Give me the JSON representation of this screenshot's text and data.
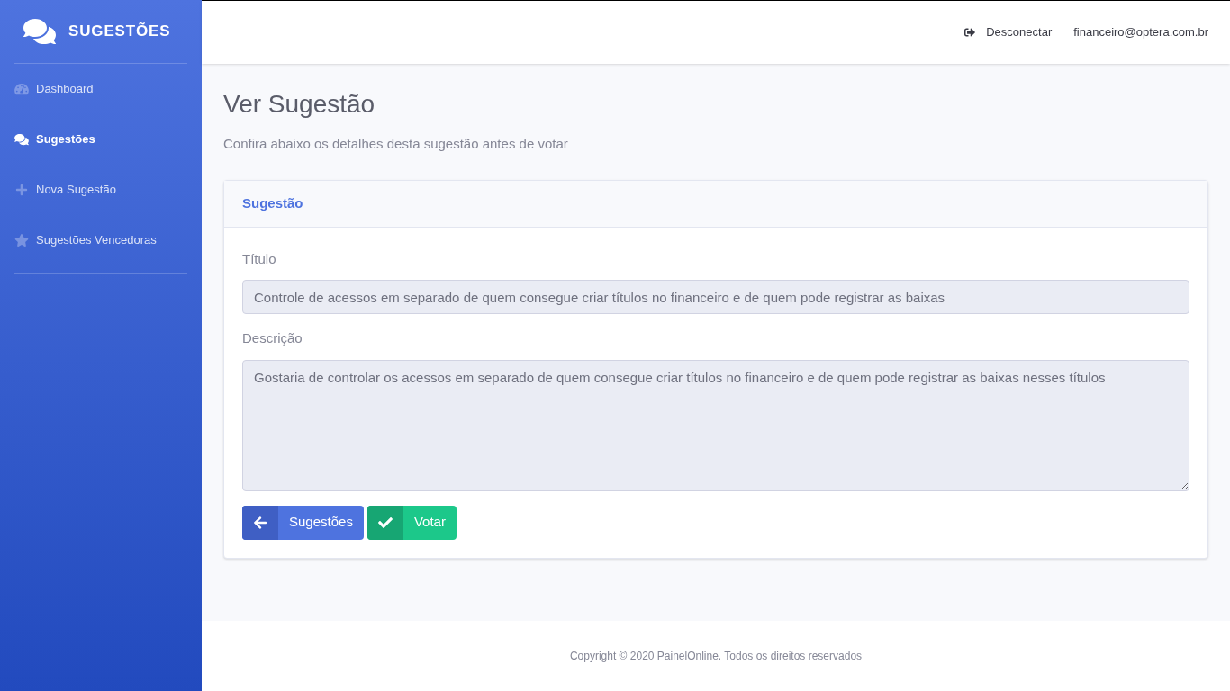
{
  "sidebar": {
    "brand": "SUGESTÕES",
    "items": [
      {
        "label": "Dashboard",
        "kind": "dashboard",
        "selected": false
      },
      {
        "label": "Sugestões",
        "kind": "list",
        "selected": true
      },
      {
        "label": "Nova Sugestão",
        "kind": "new",
        "selected": false
      },
      {
        "label": "Sugestões Vencedoras",
        "kind": "winners",
        "selected": false
      }
    ]
  },
  "topbar": {
    "logout": "Desconectar",
    "user": "financeiro@optera.com.br"
  },
  "page": {
    "title": "Ver Sugestão",
    "subtitle": "Confira abaixo os detalhes desta sugestão antes de votar"
  },
  "card": {
    "header": "Sugestão",
    "fields": [
      {
        "label": "Título",
        "kind": "input",
        "value": "Controle de acessos em separado de quem consegue criar títulos no financeiro e de quem pode registrar as baixas"
      },
      {
        "label": "Descrição",
        "kind": "textarea",
        "value": "Gostaria de controlar os acessos em separado de quem consegue criar títulos no financeiro e de quem pode registrar as baixas nesses títulos"
      }
    ],
    "buttons": [
      {
        "label": "Sugestões",
        "kind": "back"
      },
      {
        "label": "Votar",
        "kind": "vote"
      }
    ]
  },
  "footer": "Copyright © 2020 PainelOnline. Todos os direitos reservados"
}
